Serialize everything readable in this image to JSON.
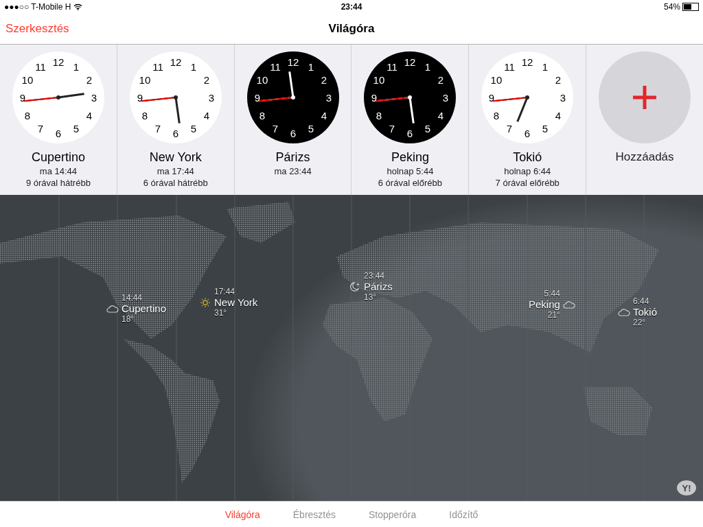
{
  "status_bar": {
    "carrier": "●●●○○ T-Mobile H",
    "time": "23:44",
    "battery": "54%"
  },
  "nav": {
    "edit": "Szerkesztés",
    "title": "Világóra"
  },
  "clocks": [
    {
      "dial": [
        "12",
        "11",
        "1",
        "10",
        "2",
        "9",
        "3",
        "8",
        "4",
        "7",
        "5",
        "6"
      ],
      "city": "Cupertino",
      "time": "ma 14:44",
      "offset": "9 órával hátrébb",
      "night": false
    },
    {
      "dial": [
        "12",
        "11",
        "1",
        "10",
        "2",
        "9",
        "3",
        "8",
        "4",
        "7",
        "5",
        "6"
      ],
      "city": "New York",
      "time": "ma 17:44",
      "offset": "6 órával hátrébb",
      "night": false
    },
    {
      "dial": [
        "12",
        "11",
        "1",
        "10",
        "2",
        "9",
        "3",
        "8",
        "4",
        "7",
        "5",
        "6"
      ],
      "city": "Párizs",
      "time": "ma 23:44",
      "night": true
    },
    {
      "dial": [
        "12",
        "11",
        "1",
        "10",
        "2",
        "9",
        "3",
        "8",
        "4",
        "7",
        "5",
        "6"
      ],
      "city": "Peking",
      "time": "holnap 5:44",
      "offset": "6 órával előrébb",
      "night": true
    },
    {
      "dial": [
        "12",
        "11",
        "1",
        "10",
        "2",
        "9",
        "3",
        "8",
        "4",
        "7",
        "5",
        "6"
      ],
      "city": "Tokió",
      "time": "holnap 6:44",
      "offset": "7 órával előrébb",
      "night": false
    }
  ],
  "add": {
    "label": "Hozzáadás"
  },
  "map_pins": [
    {
      "time": "14:44",
      "city": "Cupertino",
      "temp": "18°",
      "kind": "cloud"
    },
    {
      "time": "17:44",
      "city": "New York",
      "temp": "31°",
      "kind": "sun"
    },
    {
      "time": "23:44",
      "city": "Párizs",
      "temp": "13°",
      "kind": "moon"
    },
    {
      "time": "5:44",
      "city": "Peking",
      "temp": "21°",
      "kind": "cloud"
    },
    {
      "time": "6:44",
      "city": "Tokió",
      "temp": "22°",
      "kind": "cloud"
    }
  ],
  "map_credit": "Y!",
  "tabs": [
    {
      "label": "Világóra",
      "selected": true
    },
    {
      "label": "Ébresztés",
      "selected": false
    },
    {
      "label": "Stopperóra",
      "selected": false
    },
    {
      "label": "Időzítő",
      "selected": false
    }
  ]
}
